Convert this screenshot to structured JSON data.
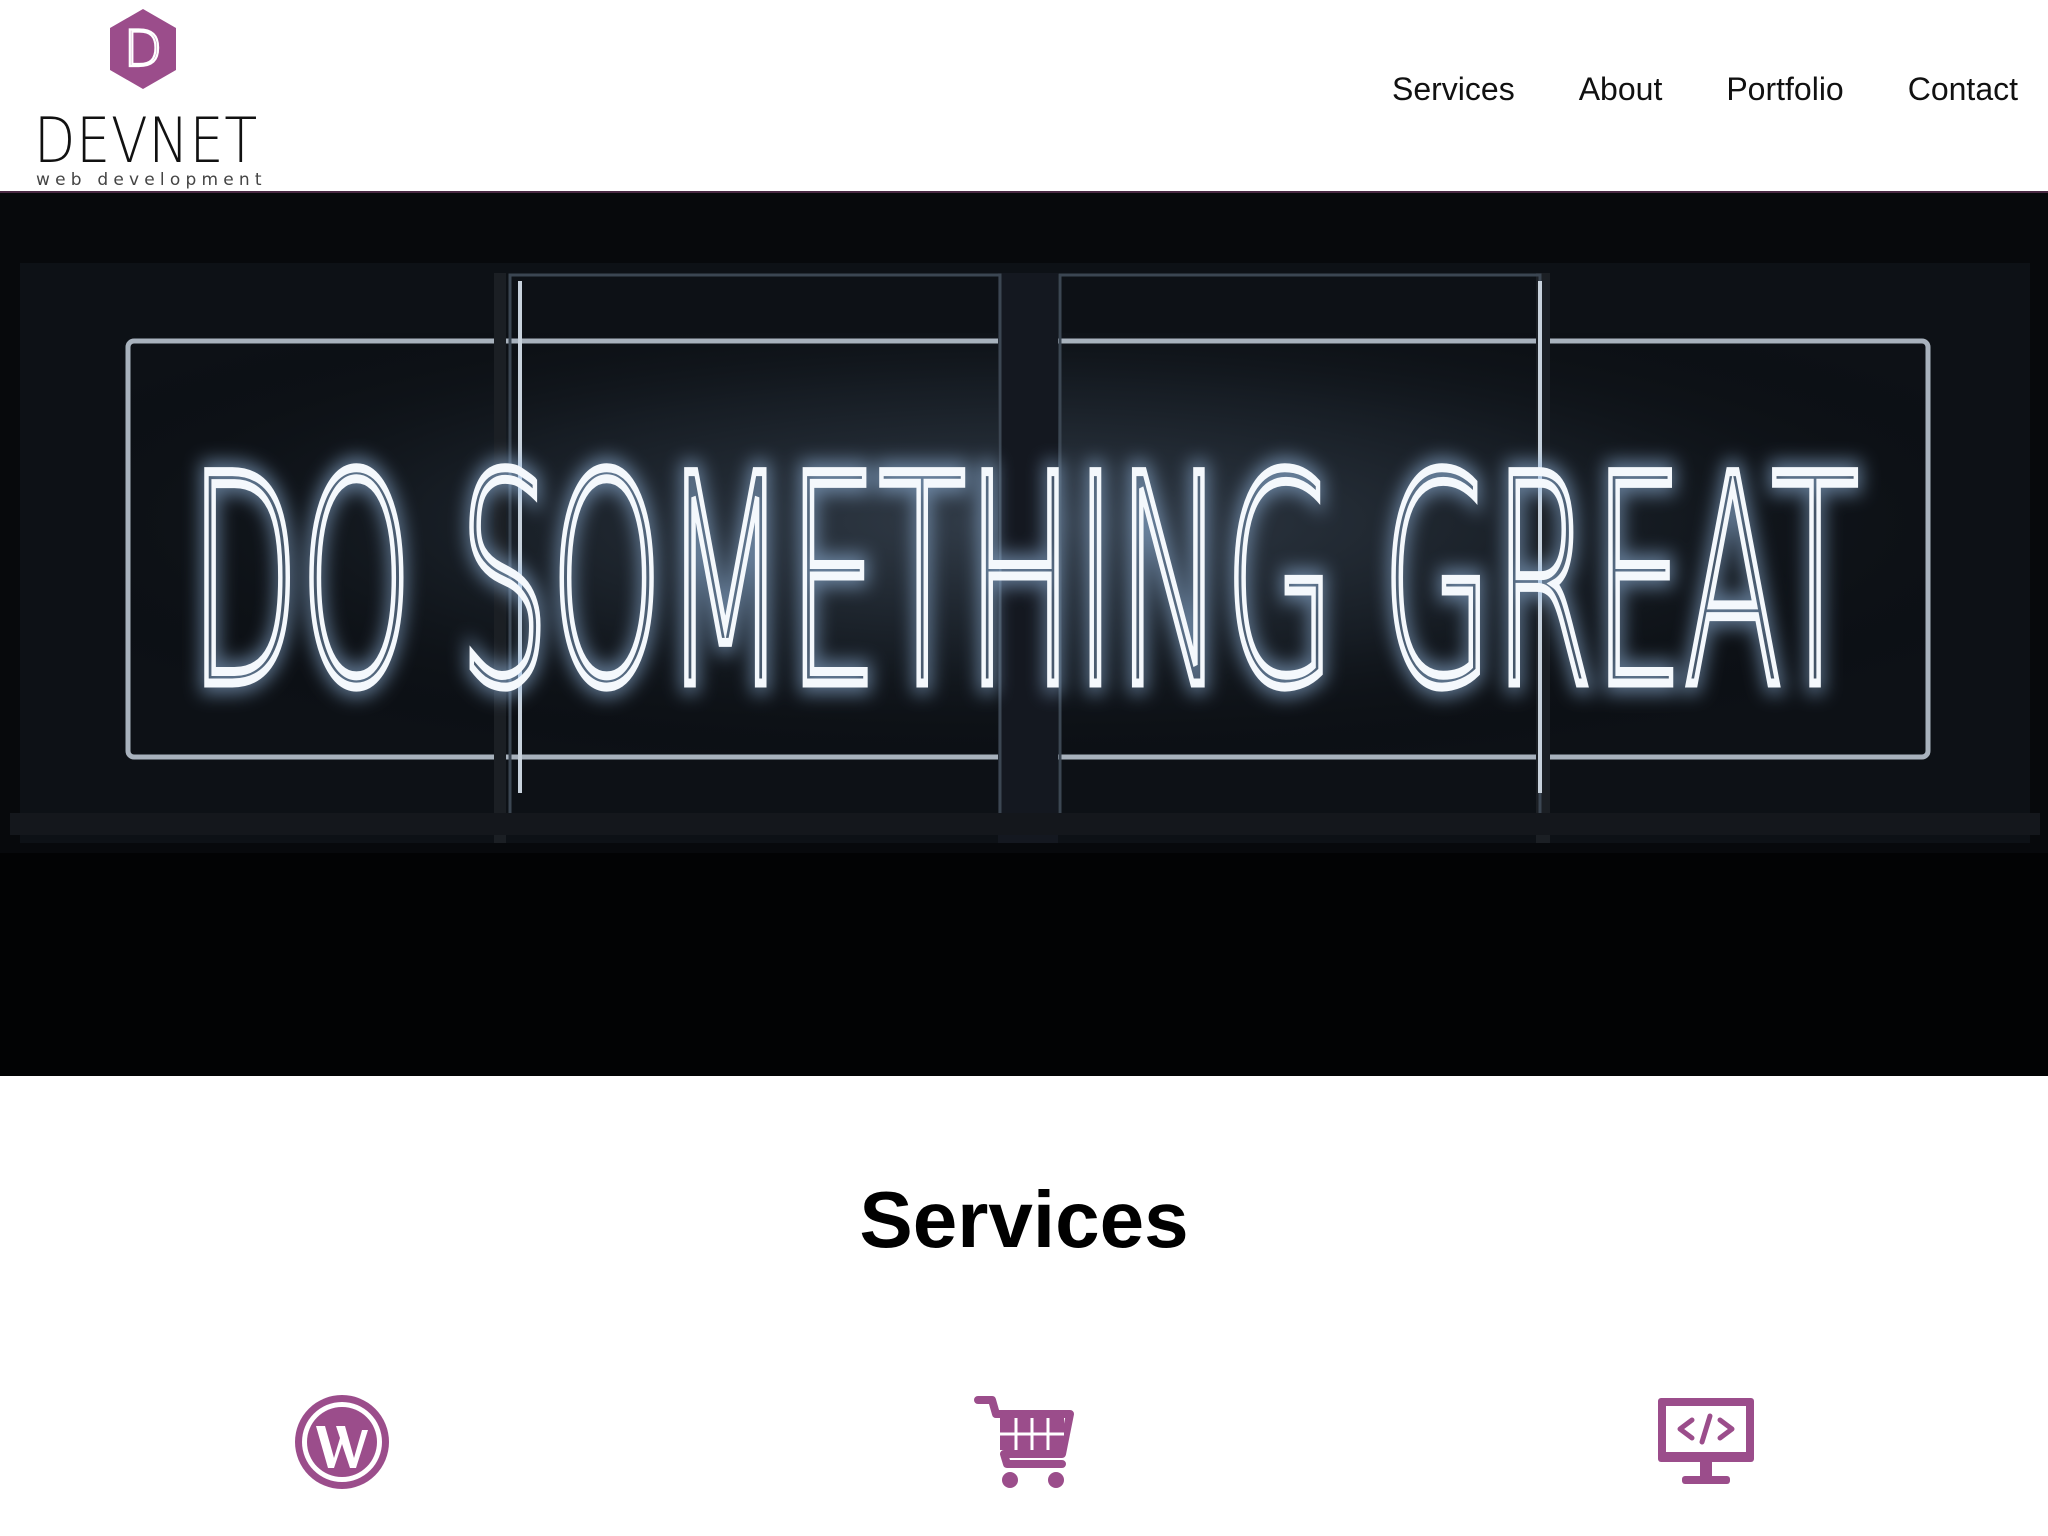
{
  "brand": {
    "logo_letter": "D",
    "name": "DEVNET",
    "tagline": "web development",
    "accent_color": "#9b4d8b"
  },
  "nav": {
    "items": [
      {
        "label": "Services"
      },
      {
        "label": "About"
      },
      {
        "label": "Portfolio"
      },
      {
        "label": "Contact"
      }
    ]
  },
  "hero": {
    "image_text": "DO SOMETHING GREAT"
  },
  "services": {
    "title": "Services",
    "icons": [
      "wordpress-icon",
      "shopping-cart-icon",
      "monitor-code-icon"
    ]
  }
}
